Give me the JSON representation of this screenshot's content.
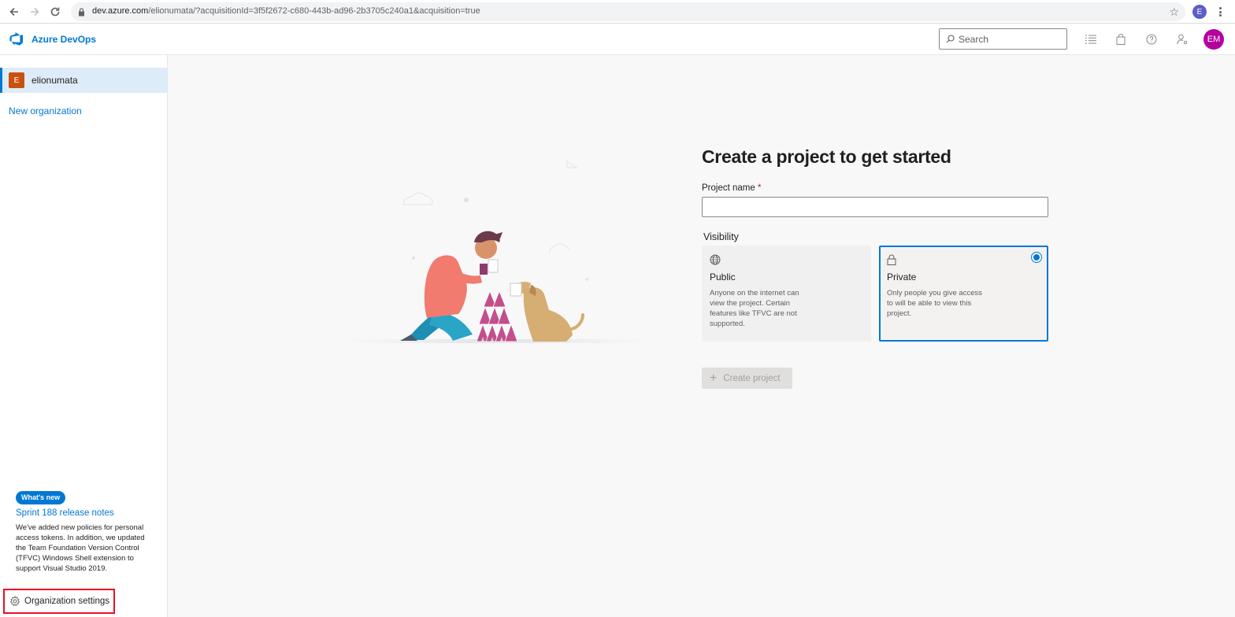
{
  "browser": {
    "url_host": "dev.azure.com",
    "url_rest": "/elionumata/?acquisitionId=3f5f2672-c680-443b-ad96-2b3705c240a1&acquisition=true",
    "profile_initial": "E"
  },
  "header": {
    "brand": "Azure DevOps",
    "search_placeholder": "Search",
    "avatar_initials": "EM",
    "icons": [
      "list-icon",
      "marketplace-bag-icon",
      "help-icon",
      "user-settings-icon"
    ]
  },
  "sidebar": {
    "organization": {
      "badge": "E",
      "name": "elionumata"
    },
    "new_org_label": "New organization",
    "whats_new": {
      "badge": "What's new",
      "link": "Sprint 188 release notes",
      "description": "We've added new policies for personal access tokens. In addition, we updated the Team Foundation Version Control (TFVC) Windows Shell extension to support Visual Studio 2019."
    },
    "org_settings_label": "Organization settings"
  },
  "main": {
    "title": "Create a project to get started",
    "project_name_label": "Project name",
    "required_mark": "*",
    "project_name_value": "",
    "visibility_label": "Visibility",
    "visibility_options": [
      {
        "title": "Public",
        "description": "Anyone on the internet can view the project. Certain features like TFVC are not supported.",
        "selected": false
      },
      {
        "title": "Private",
        "description": "Only people you give access to will be able to view this project.",
        "selected": true
      }
    ],
    "create_button": "Create project",
    "create_enabled": false
  },
  "colors": {
    "accent": "#0078d4",
    "avatar": "#b4009e",
    "org_badge": "#ca5010",
    "highlight_border": "#e81123"
  }
}
